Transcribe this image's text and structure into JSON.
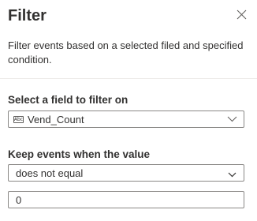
{
  "panel": {
    "title": "Filter",
    "description": "Filter events based on a selected filed and specified condition."
  },
  "field_select": {
    "label": "Select a field to filter on",
    "type_icon_text": "Abc",
    "selected_value": "Vend_Count"
  },
  "condition_select": {
    "label": "Keep events when the value",
    "selected_value": "does not equal"
  },
  "value_input": {
    "value": "0"
  },
  "icons": {
    "close": "close-icon",
    "field_chevron": "chevron-down-icon",
    "condition_chevron": "chevron-down-icon",
    "type": "string-type-icon"
  }
}
